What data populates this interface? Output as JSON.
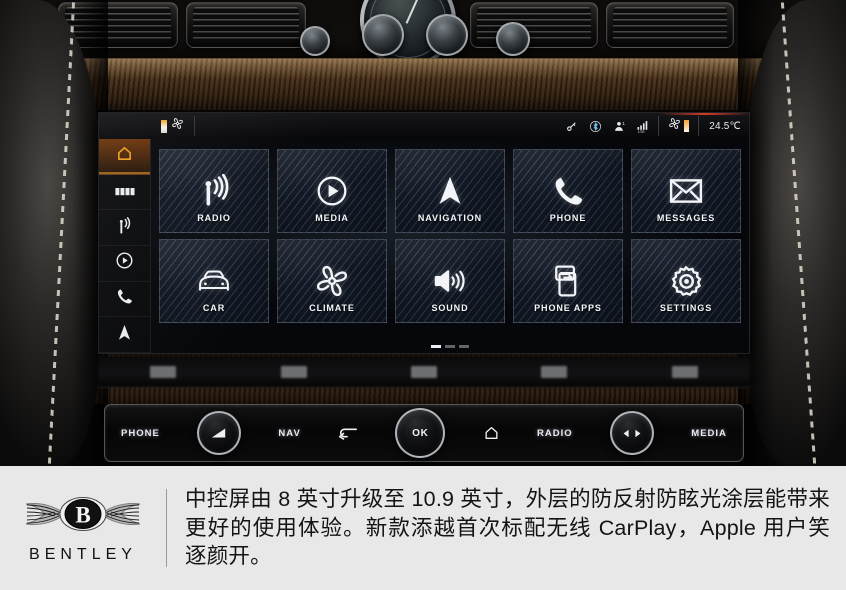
{
  "photo": {
    "description": "Bentley Bentayga centre console infotainment screen",
    "clock": "analog-dash-clock"
  },
  "screen": {
    "statusbar": {
      "left_tab_icon": "climate-fan-icon",
      "icons": [
        {
          "name": "key-icon",
          "glyph": "⚷"
        },
        {
          "name": "bluetooth-icon",
          "glyph": "ᛦ"
        },
        {
          "name": "user-profile-icon",
          "glyph": "♟"
        },
        {
          "name": "lte-signal-icon",
          "glyph": "LTE"
        }
      ],
      "climate_icon": "fan-icon",
      "temperature": "24.5℃"
    },
    "rail": [
      {
        "name": "home",
        "icon": "home-icon",
        "active": true
      },
      {
        "name": "apps",
        "icon": "apps-grid-icon",
        "active": false
      },
      {
        "name": "radio",
        "icon": "radio-tower-icon",
        "active": false
      },
      {
        "name": "media",
        "icon": "play-circle-icon",
        "active": false
      },
      {
        "name": "phone",
        "icon": "phone-handset-icon",
        "active": false
      },
      {
        "name": "navigation",
        "icon": "navigation-arrow-icon",
        "active": false
      }
    ],
    "tiles": [
      [
        {
          "label": "RADIO",
          "icon": "radio-tower-icon"
        },
        {
          "label": "MEDIA",
          "icon": "play-circle-icon"
        },
        {
          "label": "NAVIGATION",
          "icon": "navigation-arrow-icon"
        },
        {
          "label": "PHONE",
          "icon": "phone-handset-icon"
        },
        {
          "label": "MESSAGES",
          "icon": "envelope-icon"
        }
      ],
      [
        {
          "label": "CAR",
          "icon": "car-front-icon"
        },
        {
          "label": "CLIMATE",
          "icon": "fan-icon"
        },
        {
          "label": "SOUND",
          "icon": "speaker-waves-icon"
        },
        {
          "label": "PHONE APPS",
          "icon": "phone-projection-icon"
        },
        {
          "label": "SETTINGS",
          "icon": "gear-icon"
        }
      ]
    ],
    "pagination": {
      "pages": 3,
      "current": 1
    }
  },
  "controls": {
    "phone_label": "PHONE",
    "nav_label": "NAV",
    "back_icon": "back-arrow-icon",
    "ok_label": "OK",
    "home_icon": "home-icon",
    "radio_label": "RADIO",
    "media_label": "MEDIA",
    "volume_knob": "volume-knob",
    "seek_knob": "seek-knob"
  },
  "caption": {
    "brand": "BENTLEY",
    "logo": "bentley-winged-b-logo",
    "text": "中控屏由 8 英寸升级至 10.9 英寸，外层的防反射防眩光涂层能带来更好的使用体验。新款添越首次标配无线 CarPlay，Apple 用户笑逐颜开。"
  },
  "colors": {
    "accent_orange": "#f59f1e",
    "screen_bg": "#05070a",
    "caption_bg": "#e8e8e8",
    "tile_border": "#a5afc3"
  }
}
